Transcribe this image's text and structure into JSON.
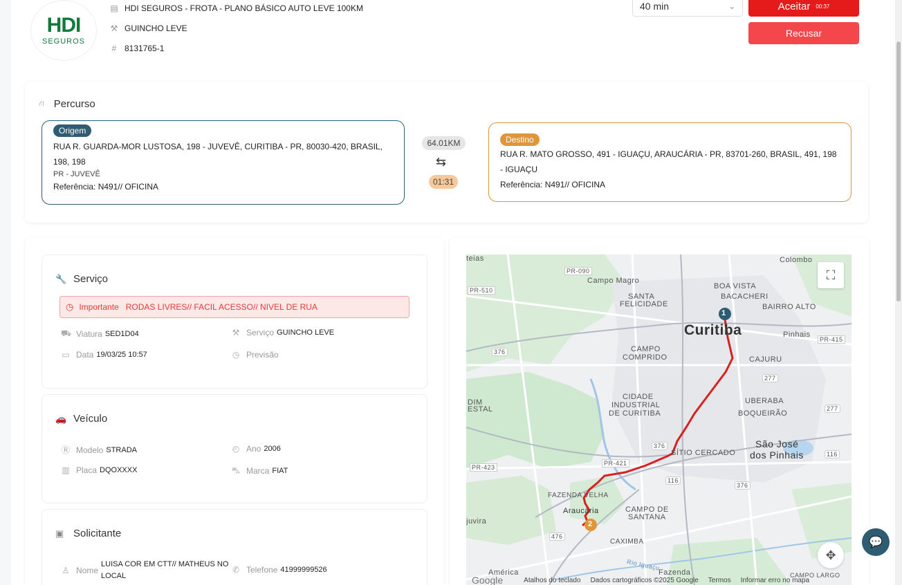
{
  "header": {
    "logo_text": "HDI",
    "logo_sub": "SEGUROS",
    "plan": "HDI SEGUROS - FROTA - PLANO BÁSICO AUTO LEVE 100KM",
    "service": "GUINCHO LEVE",
    "protocol": "8131765-1",
    "eta_select": "40 min",
    "accept_label": "Aceitar",
    "accept_timer": "00:37",
    "refuse_label": "Recusar"
  },
  "route": {
    "title": "Percurso",
    "origin": {
      "badge": "Origem",
      "address": "RUA R. GUARDA-MOR LUSTOSA, 198 - JUVEVÊ, CURITIBA - PR, 80030-420, BRASIL, 198, 198",
      "region": "PR - JUVEVÊ",
      "reference": "Referência: N491// OFICINA"
    },
    "destination": {
      "badge": "Destino",
      "address": "RUA R. MATO GROSSO, 491 - IGUAÇU, ARAUCÁRIA - PR, 83701-260, BRASIL, 491, 198 - IGUAÇU",
      "reference": "Referência: N491// OFICINA"
    },
    "distance": "64.01KM",
    "duration": "01:31"
  },
  "service_card": {
    "title": "Serviço",
    "alert_label": "Importante",
    "alert_text": "RODAS LIVRES// FACIL ACESSO// NIVEL DE RUA",
    "viatura_label": "Viatura",
    "viatura": "SED1D04",
    "servico_label": "Serviço",
    "servico": "GUINCHO LEVE",
    "data_label": "Data",
    "data": "19/03/25 10:57",
    "previsao_label": "Previsão",
    "previsao": ""
  },
  "vehicle_card": {
    "title": "Veículo",
    "modelo_label": "Modelo",
    "modelo": "STRADA",
    "ano_label": "Ano",
    "ano": "2006",
    "placa_label": "Placa",
    "placa": "DQOXXXX",
    "marca_label": "Marca",
    "marca": "FIAT"
  },
  "requester_card": {
    "title": "Solicitante",
    "nome_label": "Nome",
    "nome_line1": "LUISA COR EM CTT// MATHEUS NO",
    "nome_line2": "LOCAL",
    "telefone_label": "Telefone",
    "telefone": "41999999526"
  },
  "map": {
    "labels": {
      "teias": "teias",
      "colombo": "Colombo",
      "pr090": "PR-090",
      "campo_magro": "Campo Magro",
      "pr510": "PR-510",
      "boa_vista": "BOA VISTA",
      "santa_felicidade_1": "SANTA",
      "santa_felicidade_2": "FELICIDADE",
      "bacacheri": "BACACHERI",
      "bairro_alto": "BAIRRO ALTO",
      "curitiba": "Curitiba",
      "pinhais": "Pinhais",
      "pr415": "PR-415",
      "campo_comprido_1": "CAMPO",
      "campo_comprido_2": "COMPRIDO",
      "cajuru": "CAJURU",
      "r376a": "376",
      "r277a": "277",
      "r277b": "277",
      "cidade_ind_1": "CIDADE",
      "cidade_ind_2": "INDUSTRIAL",
      "cidade_ind_3": "DE CURITIBA",
      "uberaba": "UBERABA",
      "boqueirao": "BOQUEIRÃO",
      "dim": "DIM",
      "estal": "ESTAL",
      "r376b": "376",
      "sjp_1": "São José",
      "sjp_2": "dos Pinhais",
      "sitio_cercado": "SÍTIO CERCADO",
      "r116a": "116",
      "pr421": "PR-421",
      "pr423": "PR-423",
      "r116b": "116",
      "r376c": "376",
      "fazenda_velha": "FAZENDA VELHA",
      "araucaria": "Araucária",
      "campo_santana_1": "CAMPO DE",
      "campo_santana_2": "SANTANA",
      "juvira": "juvira",
      "caximba": "CAXIMBA",
      "r476": "476",
      "rio_iguacu": "Rio Iguaçu",
      "fazenda": "Fazenda",
      "america": "América",
      "campo_largo": "CAMPO LARGO"
    },
    "marker_start": "1",
    "marker_end": "2",
    "footer": {
      "logo": "Google",
      "keyboard": "Atalhos do teclado",
      "data": "Dados cartográficos ©2025 Google",
      "terms": "Termos",
      "report": "Informar erro no mapa"
    }
  }
}
